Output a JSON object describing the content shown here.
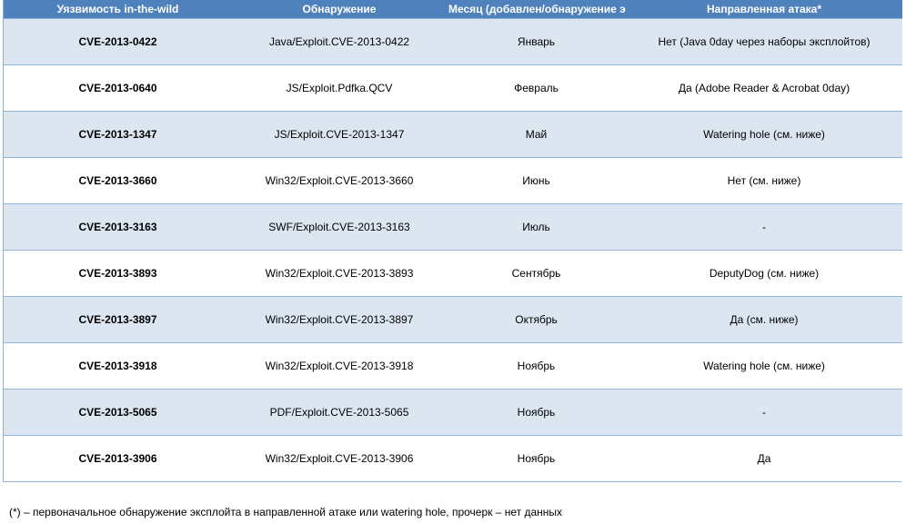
{
  "table": {
    "headers": [
      "Уязвимость in-the-wild",
      "Обнаружение",
      "Месяц (добавлен/обнаружение эксплуатации)",
      "Направленная атака*"
    ],
    "rows": [
      [
        "CVE-2013-0422",
        "Java/Exploit.CVE-2013-0422",
        "Январь",
        "Нет (Java 0day через наборы эксплойтов)"
      ],
      [
        "CVE-2013-0640",
        "JS/Exploit.Pdfka.QCV",
        "Февраль",
        "Да (Adobe Reader & Acrobat 0day)"
      ],
      [
        "CVE-2013-1347",
        "JS/Exploit.CVE-2013-1347",
        "Май",
        "Watering hole (см. ниже)"
      ],
      [
        "CVE-2013-3660",
        "Win32/Exploit.CVE-2013-3660",
        "Июнь",
        "Нет (см. ниже)"
      ],
      [
        "CVE-2013-3163",
        "SWF/Exploit.CVE-2013-3163",
        "Июль",
        "-"
      ],
      [
        "CVE-2013-3893",
        "Win32/Exploit.CVE-2013-3893",
        "Сентябрь",
        "DeputyDog (см. ниже)"
      ],
      [
        "CVE-2013-3897",
        "Win32/Exploit.CVE-2013-3897",
        "Октябрь",
        "Да (см. ниже)"
      ],
      [
        "CVE-2013-3918",
        "Win32/Exploit.CVE-2013-3918",
        "Ноябрь",
        "Watering hole (см. ниже)"
      ],
      [
        "CVE-2013-5065",
        "PDF/Exploit.CVE-2013-5065",
        "Ноябрь",
        "-"
      ],
      [
        "CVE-2013-3906",
        "Win32/Exploit.CVE-2013-3906",
        "Ноябрь",
        "Да"
      ]
    ]
  },
  "footnote": "(*) – первоначальное обнаружение эксплойта в направленной атаке или watering hole, прочерк – нет данных",
  "colors": {
    "header_bg": "#4f81bd",
    "band_bg": "#dce6f1",
    "border": "#95b3d7"
  }
}
